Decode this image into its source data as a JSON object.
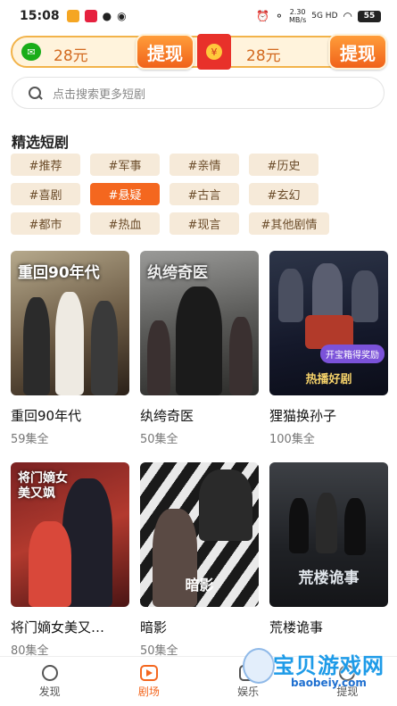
{
  "status_bar": {
    "time": "15:08",
    "net_speed": "2.30",
    "net_unit": "MB/s",
    "signal": "5G HD",
    "battery": "55"
  },
  "coins": {
    "wechat_amount": "28元",
    "withdraw_left": "提现",
    "redpacket_amount": "28元",
    "withdraw_right": "提现",
    "redpacket_symbol": "¥"
  },
  "search": {
    "placeholder": "点击搜索更多短剧"
  },
  "section": {
    "title": "精选短剧"
  },
  "tags": [
    "#推荐",
    "#军事",
    "#亲情",
    "#历史",
    "#喜剧",
    "#悬疑",
    "#古言",
    "#玄幻",
    "#都市",
    "#热血",
    "#现言",
    "#其他剧情"
  ],
  "active_tag": "#悬疑",
  "dramas": [
    {
      "name": "重回90年代",
      "episodes": "59集全",
      "poster_text": "重回90年代",
      "poster_sub": ""
    },
    {
      "name": "纨绔奇医",
      "episodes": "50集全",
      "poster_text": "纨绔奇医",
      "poster_sub": ""
    },
    {
      "name": "狸猫换孙子",
      "episodes": "100集全",
      "poster_text": "",
      "poster_sub": "热播好剧",
      "badge": "开宝箱得奖励"
    },
    {
      "name": "将门嫡女美又…",
      "episodes": "80集全",
      "poster_text": "将门嫡女美又飒",
      "poster_sub": ""
    },
    {
      "name": "暗影",
      "episodes": "50集全",
      "poster_text": "",
      "poster_sub": "暗影"
    },
    {
      "name": "荒楼诡事",
      "episodes": "",
      "poster_text": "",
      "poster_sub": "荒楼诡事"
    }
  ],
  "tabbar": {
    "discover": "发现",
    "theater": "剧场",
    "entertainment": "娱乐",
    "withdraw": "提现"
  },
  "watermark": {
    "text": "宝贝游戏网",
    "url": "baobeiy.com"
  },
  "colors": {
    "accent": "#f4671f",
    "tag_bg": "#f6ead9",
    "wechat": "#1aad19"
  }
}
